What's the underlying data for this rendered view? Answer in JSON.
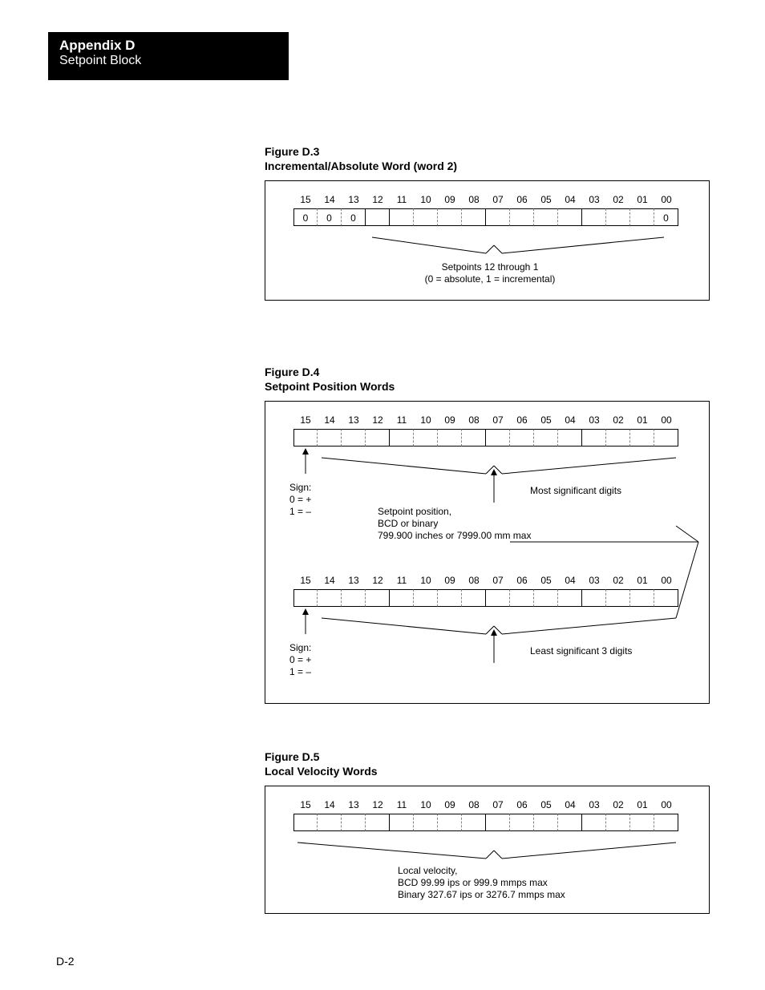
{
  "header": {
    "title": "Appendix D",
    "subtitle": "Setpoint Block"
  },
  "pageNumber": "D-2",
  "bits": [
    "15",
    "14",
    "13",
    "12",
    "11",
    "10",
    "09",
    "08",
    "07",
    "06",
    "05",
    "04",
    "03",
    "02",
    "01",
    "00"
  ],
  "figD3": {
    "captionA": "Figure D.3",
    "captionB": "Incremental/Absolute Word (word 2)",
    "cells": [
      "0",
      "0",
      "0",
      "",
      "",
      "",
      "",
      "",
      "",
      "",
      "",
      "",
      "",
      "",
      "",
      "0"
    ],
    "note1": "Setpoints 12 through 1",
    "note2": "(0 = absolute, 1 = incremental)"
  },
  "figD4": {
    "captionA": "Figure D.4",
    "captionB": "Setpoint Position Words",
    "signLabel": "Sign:",
    "signPlus": "0 = +",
    "signMinus": "1 = –",
    "centerLine1": "Setpoint position,",
    "centerLine2": "BCD or binary",
    "centerLine3": "799.900 inches or 7999.00 mm max",
    "rightTop": "Most significant digits",
    "rightBot": "Least significant 3 digits"
  },
  "figD5": {
    "captionA": "Figure D.5",
    "captionB": "Local Velocity Words",
    "line1": "Local velocity,",
    "line2": "BCD 99.99 ips or 999.9 mmps max",
    "line3": "Binary 327.67 ips or 3276.7 mmps max"
  }
}
